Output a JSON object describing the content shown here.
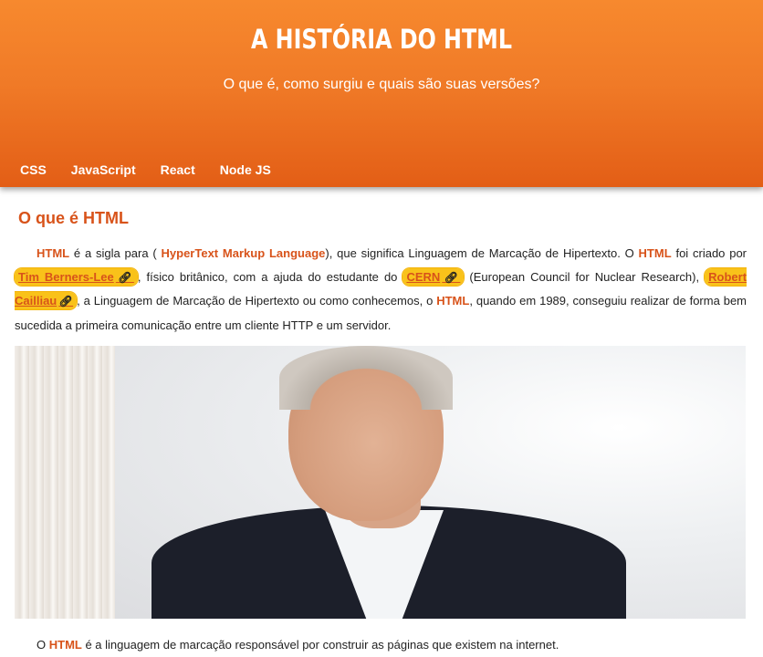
{
  "header": {
    "title": "A HISTÓRIA DO HTML",
    "subtitle": "O que é, como surgiu e quais são suas versões?"
  },
  "nav": {
    "items": [
      {
        "label": "CSS"
      },
      {
        "label": "JavaScript"
      },
      {
        "label": "React"
      },
      {
        "label": "Node JS"
      }
    ]
  },
  "section": {
    "title": "O que é HTML",
    "p1": {
      "html1": "HTML",
      "t1": " é a sigla para ( ",
      "hypertext": "HyperText Markup Language",
      "t2": "), que significa Linguagem de Marcação de Hipertexto. O ",
      "html2": "HTML",
      "t3": " foi criado por ",
      "tim": "Tim Berners-Lee",
      "t4": ", físico britânico, com a ajuda do estudante do ",
      "cern": "CERN",
      "t5": " (European Council for Nuclear Research), ",
      "robert": "Robert Cailliau",
      "t6": ", a Linguagem de Marcação de Hipertexto ou como conhecemos, o ",
      "html3": "HTML",
      "t7": ", quando em 1989, conseguiu realizar de forma bem sucedida a primeira comunicação entre um cliente HTTP e um servidor."
    },
    "p2": {
      "t1": "O ",
      "html": "HTML",
      "t2": " é a linguagem de marcação responsável por construir as páginas que existem na internet."
    },
    "link_icon": "link-icon",
    "photo_icon": "portrait-photo"
  },
  "colors": {
    "header_top": "#f7892e",
    "header_bottom": "#e35e16",
    "accent": "#d8531a",
    "pill": "#f9c21a"
  }
}
